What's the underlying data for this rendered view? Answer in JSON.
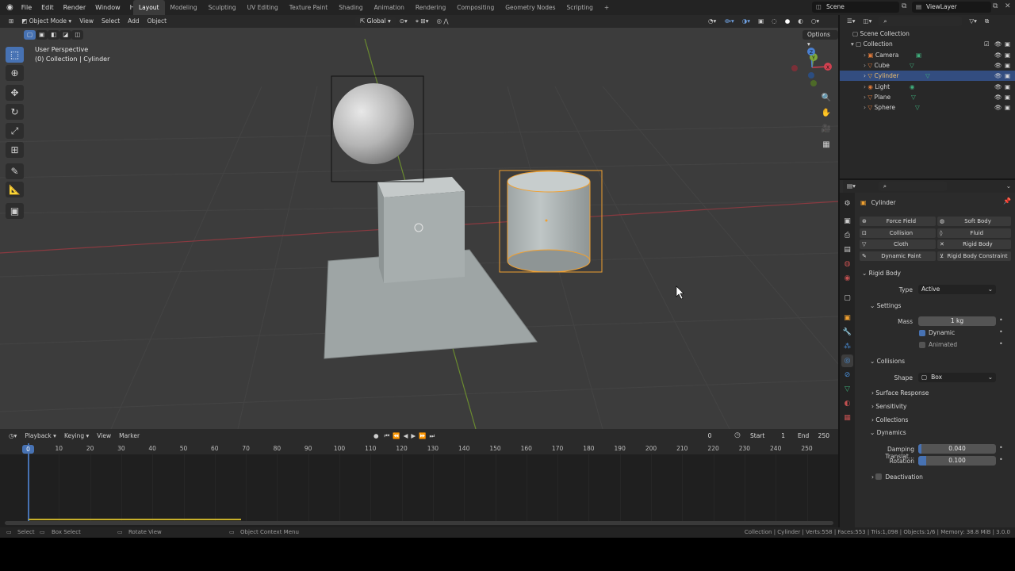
{
  "topbar": {
    "menus": [
      "File",
      "Edit",
      "Render",
      "Window",
      "Help"
    ],
    "workspaces": [
      "Layout",
      "Modeling",
      "Sculpting",
      "UV Editing",
      "Texture Paint",
      "Shading",
      "Animation",
      "Rendering",
      "Compositing",
      "Geometry Nodes",
      "Scripting"
    ],
    "active_workspace": "Layout",
    "add_tab": "+",
    "scene": "Scene",
    "view_layer": "ViewLayer"
  },
  "viewport": {
    "mode": "Object Mode",
    "menus": [
      "View",
      "Select",
      "Add",
      "Object"
    ],
    "orientation": "Global",
    "options": "Options",
    "info_line1": "User Perspective",
    "info_line2": "(0) Collection | Cylinder",
    "gizmo": {
      "x": "X",
      "y": "Y",
      "z": "Z"
    }
  },
  "outliner": {
    "root": "Scene Collection",
    "collection": "Collection",
    "items": [
      {
        "name": "Cube"
      },
      {
        "name": "Camera"
      },
      {
        "name": "Cube"
      },
      {
        "name": "Cylinder"
      },
      {
        "name": "Light"
      },
      {
        "name": "Plane"
      },
      {
        "name": "Sphere"
      }
    ],
    "selected_index": 3
  },
  "properties": {
    "object_name": "Cylinder",
    "physics_buttons": {
      "force_field": "Force Field",
      "soft_body": "Soft Body",
      "collision": "Collision",
      "fluid": "Fluid",
      "cloth": "Cloth",
      "rigid_body": "Rigid Body",
      "dynamic_paint": "Dynamic Paint",
      "rigid_body_constraint": "Rigid Body Constraint"
    },
    "rigid_body": {
      "title": "Rigid Body",
      "type_label": "Type",
      "type_value": "Active",
      "settings": "Settings",
      "mass_label": "Mass",
      "mass_value": "1 kg",
      "dynamic": "Dynamic",
      "dynamic_checked": true,
      "animated": "Animated",
      "animated_checked": false,
      "collisions": "Collisions",
      "shape_label": "Shape",
      "shape_value": "Box",
      "surface_response": "Surface Response",
      "sensitivity": "Sensitivity",
      "collections": "Collections",
      "dynamics": "Dynamics",
      "damping_translation_label": "Damping Translat...",
      "damping_translation_value": "0.040",
      "damping_translation_fraction": 0.04,
      "rotation_label": "Rotation",
      "rotation_value": "0.100",
      "rotation_fraction": 0.1,
      "deactivation": "Deactivation"
    }
  },
  "timeline": {
    "menus": [
      "Playback",
      "Keying",
      "View",
      "Marker"
    ],
    "current_frame": "0",
    "start_label": "Start",
    "start_value": "1",
    "end_label": "End",
    "end_value": "250",
    "ticks": [
      "0",
      "10",
      "20",
      "30",
      "40",
      "50",
      "60",
      "70",
      "80",
      "90",
      "100",
      "110",
      "120",
      "130",
      "140",
      "150",
      "160",
      "170",
      "180",
      "190",
      "200",
      "210",
      "220",
      "230",
      "240",
      "250"
    ]
  },
  "status": {
    "select": "Select",
    "box_select": "Box Select",
    "rotate_view": "Rotate View",
    "context_menu": "Object Context Menu",
    "stats": "Collection | Cylinder | Verts:558 | Faces:553 | Tris:1,098 | Objects:1/6 | Memory: 38.8 MiB | 3.0.0"
  },
  "colors": {
    "accent": "#4772b3",
    "selection": "#334d80",
    "active_object": "#f0a030",
    "x_axis": "#b8404a",
    "y_axis": "#7ea83a"
  }
}
